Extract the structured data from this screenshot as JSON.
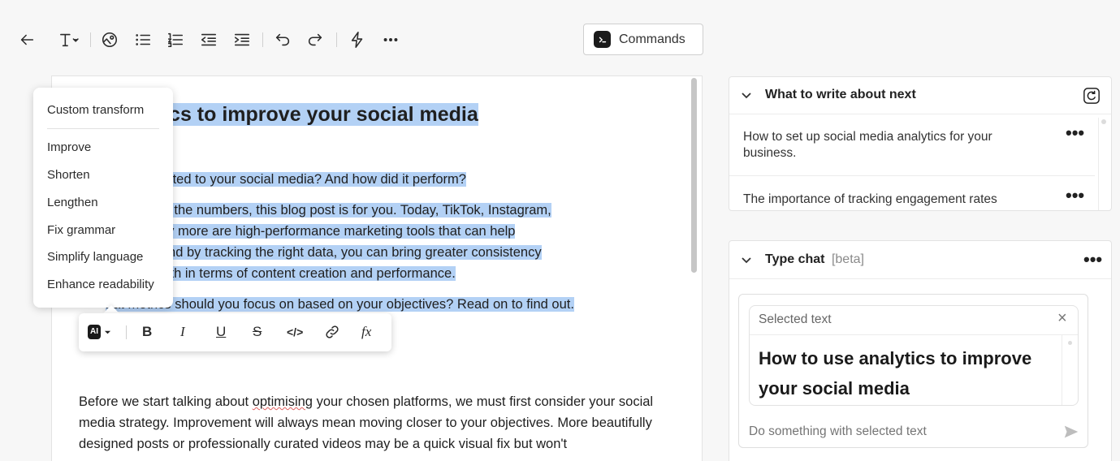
{
  "toolbar": {
    "commands_label": "Commands"
  },
  "document": {
    "title_visible": "e analytics to improve your social media",
    "line1": "st thing you posted to your social media? And how did it perform?",
    "p2_lines": [
      "ll the content or the numbers, this blog post is for you. Today, TikTok, Instagram,",
      "book, and many more are high-performance marketing tools that can help",
      "siness goals. And by tracking the right data, you can bring greater consistency",
      "edia activity, both in terms of content creation and performance."
    ],
    "line_objectives": "hat metrics should you focus on based on your objectives? Read on to find out.",
    "body_before": "Before we start talking about ",
    "body_misspelled": "optimising",
    "body_after": " your chosen platforms, we must first consider your social media strategy. Improvement will always mean moving closer to your objectives. More beautifully designed posts or professionally curated videos may be a quick visual fix but won't"
  },
  "ai_menu": {
    "custom": "Custom transform",
    "items": [
      "Improve",
      "Shorten",
      "Lengthen",
      "Fix grammar",
      "Simplify language",
      "Enhance readability"
    ]
  },
  "format_toolbar": {
    "ai_label": "AI",
    "bold": "B",
    "italic": "I",
    "underline": "U",
    "strike": "S",
    "code": "</>",
    "formula": "fx"
  },
  "suggestions_panel": {
    "title": "What to write about next",
    "items": [
      "How to set up social media analytics for your business.",
      "The importance of tracking engagement rates"
    ]
  },
  "chat_panel": {
    "title": "Type chat",
    "beta": "[beta]",
    "selected_label": "Selected text",
    "selected_content": "How to use analytics to improve your social media",
    "input_placeholder": "Do something with selected text"
  }
}
